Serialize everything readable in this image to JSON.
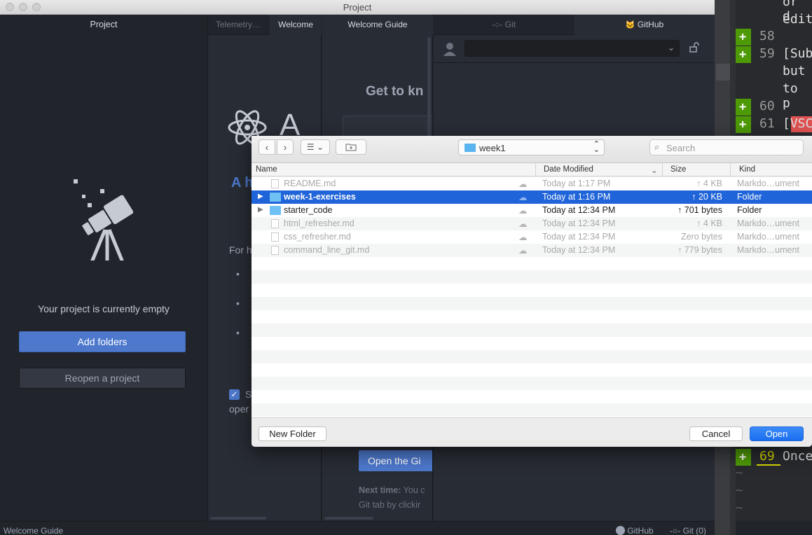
{
  "window": {
    "title": "Project"
  },
  "project_panel": {
    "header": "Project",
    "empty_message": "Your project is currently empty",
    "add_folders": "Add folders",
    "reopen_project": "Reopen a project"
  },
  "tabs": {
    "telemetry": "Telemetry…",
    "welcome": "Welcome",
    "welcome_guide": "Welcome Guide",
    "git": "Git",
    "github": "GitHub"
  },
  "welcome": {
    "atom_word": "A",
    "subtitle_partial": "A h",
    "for_help": "For h",
    "checkbox_partial": "S",
    "open_partial": "oper"
  },
  "guide": {
    "heading_partial": "Get to kn",
    "open_git_partial": "Open the Gi",
    "next_time_label": "Next time:",
    "next_time_text": " You c",
    "line2_partial": "Git tab by clickir"
  },
  "statusbar": {
    "left": "Welcome Guide",
    "github": "GitHub",
    "git": "Git (0)"
  },
  "editor": {
    "lines": [
      {
        "num": "",
        "text": "or d",
        "plus": false
      },
      {
        "num": "",
        "text": "edit",
        "plus": false
      },
      {
        "num": "58",
        "text": "",
        "plus": true
      },
      {
        "num": "59",
        "text": "[Sub",
        "plus": true
      },
      {
        "num": "",
        "text": "but",
        "plus": false
      },
      {
        "num": "",
        "text": "to p",
        "plus": false
      },
      {
        "num": "60",
        "text": "",
        "plus": true
      },
      {
        "num": "61",
        "text": "[VSC",
        "plus": true
      },
      {
        "num": "69",
        "text": "Once",
        "plus": true
      }
    ],
    "tildes": [
      "~",
      "~",
      "~",
      "~"
    ]
  },
  "dialog": {
    "location": "week1",
    "search_placeholder": "Search",
    "columns": {
      "name": "Name",
      "date": "Date Modified",
      "size": "Size",
      "kind": "Kind"
    },
    "files": [
      {
        "name": "README.md",
        "date": "Today at 1:17 PM",
        "size": "↑ 4 KB",
        "kind": "Markdo…ument",
        "type": "file",
        "dim": true,
        "selected": false
      },
      {
        "name": "week-1-exercises",
        "date": "Today at 1:16 PM",
        "size": "↑ 20 KB",
        "kind": "Folder",
        "type": "folder",
        "dim": false,
        "selected": true
      },
      {
        "name": "starter_code",
        "date": "Today at 12:34 PM",
        "size": "↑ 701 bytes",
        "kind": "Folder",
        "type": "folder",
        "dim": false,
        "selected": false
      },
      {
        "name": "html_refresher.md",
        "date": "Today at 12:34 PM",
        "size": "↑ 4 KB",
        "kind": "Markdo…ument",
        "type": "file",
        "dim": true,
        "selected": false
      },
      {
        "name": "css_refresher.md",
        "date": "Today at 12:34 PM",
        "size": "Zero bytes",
        "kind": "Markdo…ument",
        "type": "file",
        "dim": true,
        "selected": false
      },
      {
        "name": "command_line_git.md",
        "date": "Today at 12:34 PM",
        "size": "↑ 779 bytes",
        "kind": "Markdo…ument",
        "type": "file",
        "dim": true,
        "selected": false
      }
    ],
    "new_folder": "New Folder",
    "cancel": "Cancel",
    "open": "Open"
  },
  "colors": {
    "accent_blue": "#4d78cc",
    "selection_blue": "#1f64d8",
    "diff_plus_green": "#4e9a06",
    "line_highlight": "#d8d800",
    "vsc_red": "#e05252"
  }
}
